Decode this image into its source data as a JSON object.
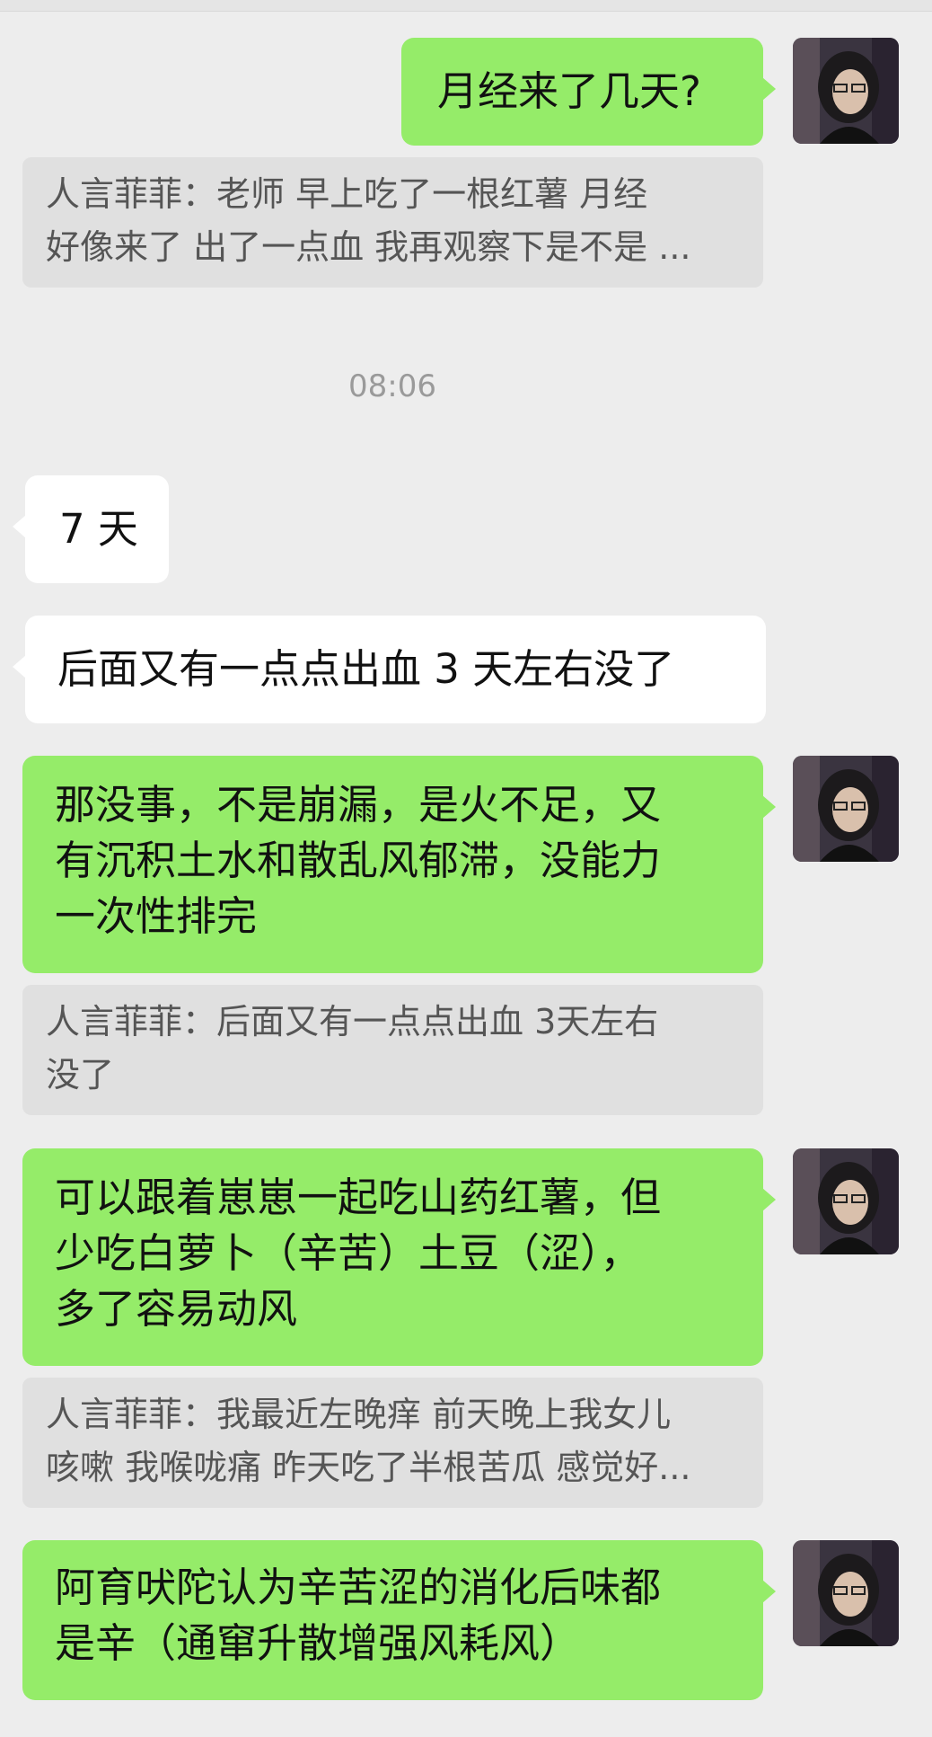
{
  "timestamp": "08:06",
  "messages": [
    {
      "text": "月经来了几天?"
    },
    {
      "quote_lines": [
        "人言菲菲：老师 早上吃了一根红薯 月经",
        "好像来了 出了一点血 我再观察下是不是 ..."
      ]
    },
    {
      "text": "7 天"
    },
    {
      "text": "后面又有一点点出血 3 天左右没了"
    },
    {
      "lines": [
        "那没事，不是崩漏，是火不足，又",
        "有沉积土水和散乱风郁滞，没能力",
        "一次性排完"
      ]
    },
    {
      "quote_lines": [
        "人言菲菲：后面又有一点点出血 3天左右",
        "没了"
      ]
    },
    {
      "lines": [
        "可以跟着崽崽一起吃山药红薯，但",
        "少吃白萝卜（辛苦）土豆（涩），",
        "多了容易动风"
      ]
    },
    {
      "quote_lines": [
        "人言菲菲：我最近左晚痒 前天晚上我女儿",
        "咳嗽 我喉咙痛 昨天吃了半根苦瓜 感觉好..."
      ]
    },
    {
      "lines": [
        "阿育吠陀认为辛苦涩的消化后味都",
        "是辛（通窜升散增强风耗风）"
      ]
    }
  ],
  "colors": {
    "background": "#ededed",
    "own_bubble": "#95ec69",
    "other_bubble": "#ffffff",
    "quote_bubble": "#e0e0e0"
  }
}
